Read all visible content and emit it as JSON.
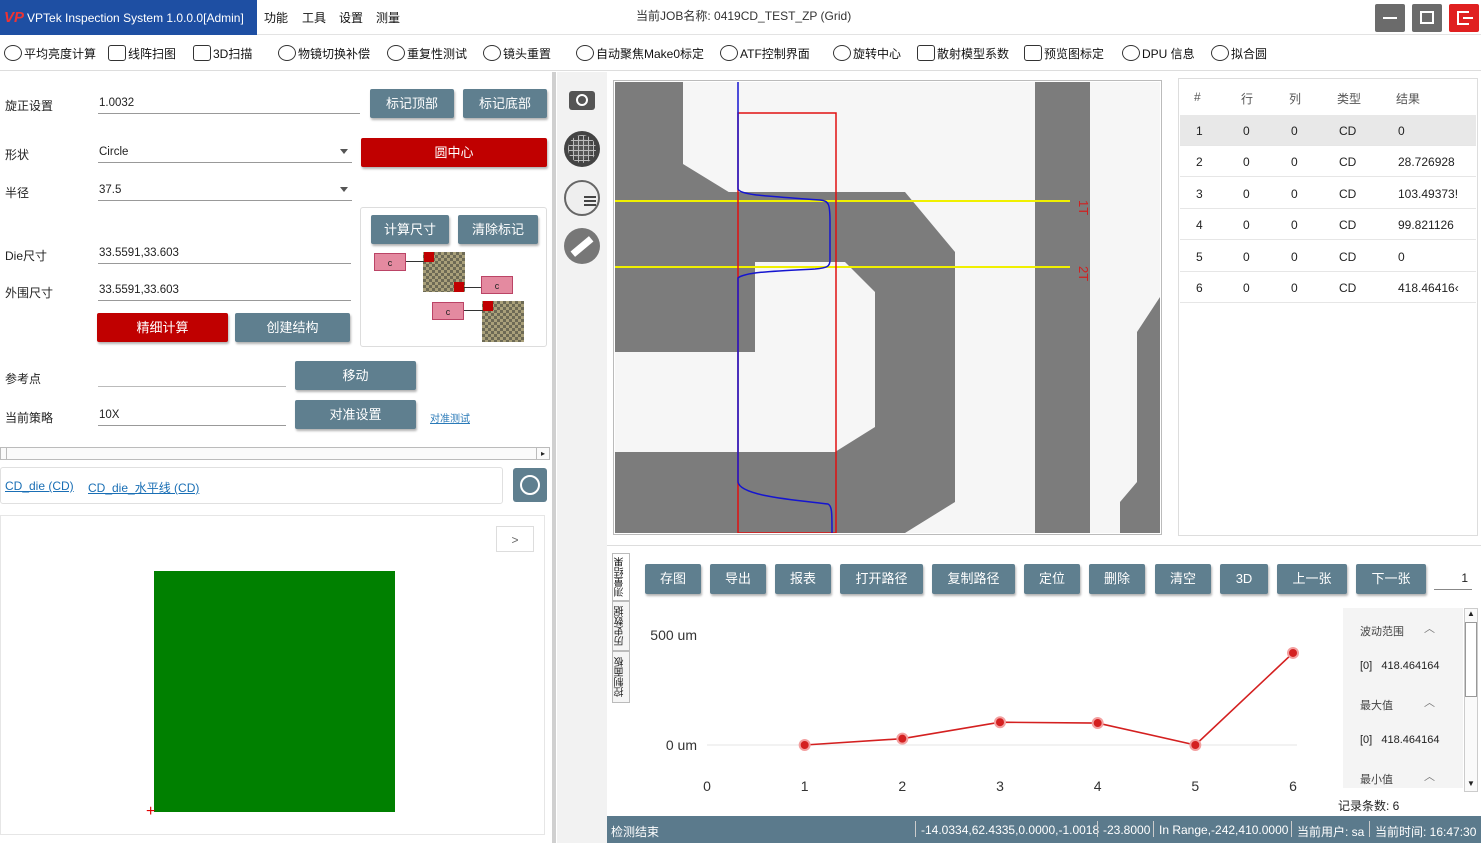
{
  "app": {
    "title": "VPTek Inspection System 1.0.0.0[Admin]",
    "logo": "VP"
  },
  "menu": [
    "功能",
    "工具",
    "设置",
    "测量"
  ],
  "job": {
    "label": "当前JOB名称:",
    "name": "0419CD_TEST_ZP (Grid)"
  },
  "toolbar": {
    "items": [
      "平均亮度计算",
      "线阵扫图",
      "3D扫描",
      "物镜切换补偿",
      "重复性测试",
      "镜头重置",
      "自动聚焦Make0标定",
      "ATF控制界面",
      "旋转中心",
      "散射模型系数",
      "预览图标定",
      "DPU 信息",
      "拟合圆"
    ]
  },
  "left": {
    "rotation_label": "旋正设置",
    "rotation_value": "1.0032",
    "mark_top": "标记顶部",
    "mark_bottom": "标记底部",
    "shape_label": "形状",
    "shape_value": "Circle",
    "circle_center": "圆中心",
    "radius_label": "半径",
    "radius_value": "37.5",
    "calc_size": "计算尺寸",
    "clear_mark": "清除标记",
    "die_label": "Die尺寸",
    "die_value": "33.5591,33.603",
    "outer_label": "外围尺寸",
    "outer_value": "33.5591,33.603",
    "fine_calc": "精细计算",
    "create_struct": "创建结构",
    "ref_label": "参考点",
    "ref_value": "",
    "move": "移动",
    "strategy_label": "当前策略",
    "strategy_value": "10X",
    "align_settings": "对准设置",
    "align_test": "对准测试",
    "c_label": "c",
    "links": [
      "CD_die (CD)",
      "CD_die_水平线 (CD)"
    ],
    "expand": ">"
  },
  "image": {
    "line1": "1T",
    "line2": "2T"
  },
  "table": {
    "headers": [
      "#",
      "行",
      "列",
      "类型",
      "结果"
    ],
    "rows": [
      [
        "1",
        "0",
        "0",
        "CD",
        "0"
      ],
      [
        "2",
        "0",
        "0",
        "CD",
        "28.726928"
      ],
      [
        "3",
        "0",
        "0",
        "CD",
        "103.49373!"
      ],
      [
        "4",
        "0",
        "0",
        "CD",
        "99.821126"
      ],
      [
        "5",
        "0",
        "0",
        "CD",
        "0"
      ],
      [
        "6",
        "0",
        "0",
        "CD",
        "418.46416‹"
      ]
    ]
  },
  "vtabs": [
    "测量结果",
    "历史数据",
    "控制面板"
  ],
  "bottom_buttons": [
    "存图",
    "导出",
    "报表",
    "打开路径",
    "复制路径",
    "定位",
    "删除",
    "清空",
    "3D",
    "上一张",
    "下一张"
  ],
  "page_input": "1",
  "stats": {
    "range_label": "波动范围",
    "range_value": "[0]   418.464164",
    "max_label": "最大值",
    "max_value": "[0]   418.464164",
    "min_label": "最小值",
    "count": "记录条数: 6"
  },
  "chart_data": {
    "type": "line",
    "x": [
      1,
      2,
      3,
      4,
      5,
      6
    ],
    "xticks": [
      "0",
      "1",
      "2",
      "3",
      "4",
      "5",
      "6"
    ],
    "yticks": [
      "500 um",
      "0 um"
    ],
    "values": [
      0,
      28.726928,
      103.49373,
      99.821126,
      0,
      418.464164
    ],
    "ylim": [
      -120,
      500
    ],
    "xlim": [
      0,
      6
    ],
    "color": "#d42020"
  },
  "status": {
    "left": "检测结束",
    "pos": "-14.0334,62.4335,0.0000,-1.0018",
    "z": "-23.8000",
    "range": "In Range,-242,410.0000",
    "user": "当前用户: sa",
    "time": "当前时间: 16:47:30"
  },
  "colors": {
    "accent": "#1e4fa3",
    "button": "#5f7f8f",
    "danger": "#c00000",
    "green": "#008000",
    "status": "#5b7a8c"
  }
}
